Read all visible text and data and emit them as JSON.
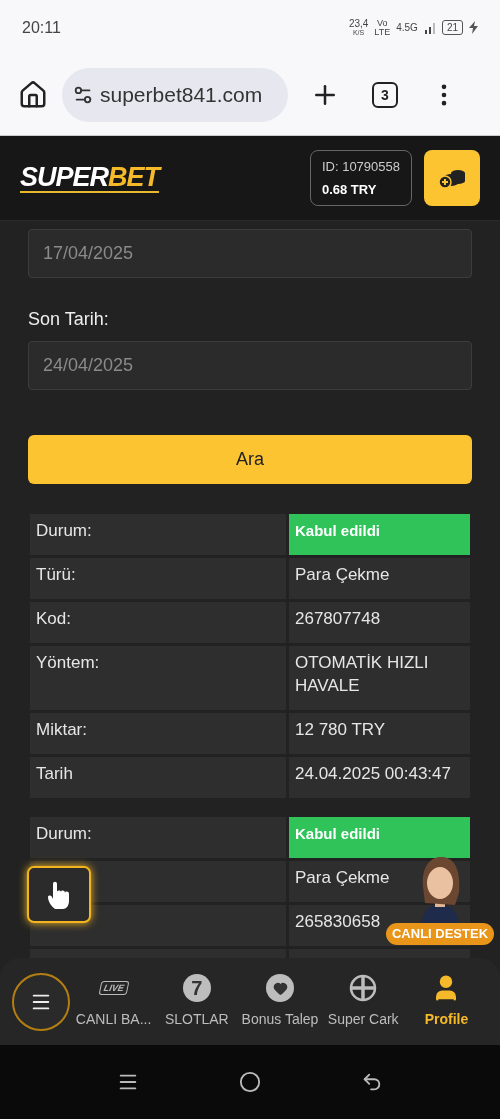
{
  "status_bar": {
    "time": "20:11",
    "speed": "23,4",
    "speed_unit": "K/S",
    "volte_top": "Vo",
    "volte_bottom": "LTE",
    "network": "4.5G",
    "battery": "21"
  },
  "browser": {
    "url": "superbet841.com",
    "tab_count": "3"
  },
  "header": {
    "logo": {
      "part_1": "SUPER",
      "part_2": "BET"
    },
    "account_id": "ID: 10790558",
    "balance": "0.68 TRY"
  },
  "filters": {
    "start_date": "17/04/2025",
    "end_label": "Son Tarih:",
    "end_date": "24/04/2025",
    "search_button": "Ara"
  },
  "transactions": [
    {
      "rows": [
        {
          "label": "Durum:",
          "value": "Kabul edildi",
          "kind": "status"
        },
        {
          "label": "Türü:",
          "value": "Para Çekme",
          "kind": "text"
        },
        {
          "label": "Kod:",
          "value": "267807748",
          "kind": "text"
        },
        {
          "label": "Yöntem:",
          "value": "OTOMATİK HIZLI HAVALE",
          "kind": "text"
        },
        {
          "label": "Miktar:",
          "value": "12 780 TRY",
          "kind": "text"
        },
        {
          "label": "Tarih",
          "value": "24.04.2025 00:43:47",
          "kind": "text"
        }
      ]
    },
    {
      "rows": [
        {
          "label": "Durum:",
          "value": "Kabul edildi",
          "kind": "status"
        },
        {
          "value": "Para Çekme",
          "kind": "text"
        },
        {
          "value": "265830658",
          "kind": "text"
        }
      ]
    }
  ],
  "support_badge": "CANLI DESTEK",
  "bottom_nav": [
    {
      "kind": "menu",
      "selected": false
    },
    {
      "kind": "live",
      "icon_text": "LIVE",
      "label": "CANLI BA...",
      "selected": false
    },
    {
      "kind": "slot",
      "icon_text": "7",
      "label": "SLOTLAR",
      "selected": false
    },
    {
      "kind": "heart",
      "label": "Bonus Talep",
      "selected": false
    },
    {
      "kind": "wheel",
      "label": "Super Cark",
      "selected": false
    },
    {
      "kind": "profile",
      "label": "Profile",
      "selected": true
    }
  ]
}
